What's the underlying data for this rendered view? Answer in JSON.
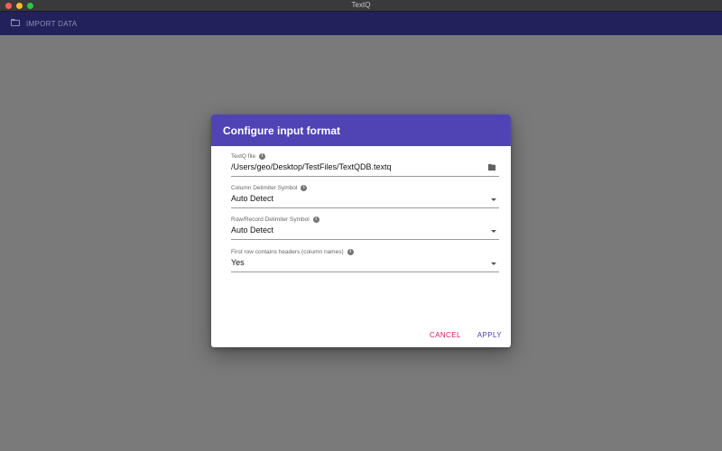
{
  "window": {
    "title": "TextQ"
  },
  "appbar": {
    "import_label": "IMPORT DATA",
    "icon": "folder-outline-icon"
  },
  "colors": {
    "appbar": "#22215c",
    "dialog_header": "#5044b4",
    "backdrop": "#7a7a7a",
    "cancel": "#d81b60",
    "apply": "#4a3fa6"
  },
  "dialog": {
    "title": "Configure input format",
    "fields": [
      {
        "label": "TextQ file",
        "value": "/Users/geo/Desktop/TestFiles/TextQDB.textq",
        "icon": "folder-icon"
      },
      {
        "label": "Column Delimiter Symbol",
        "value": "Auto Detect"
      },
      {
        "label": "Row/Record Delimiter Symbol",
        "value": "Auto Detect"
      },
      {
        "label": "First row contains headers (column names)",
        "value": "Yes"
      }
    ],
    "cancel_label": "CANCEL",
    "apply_label": "APPLY"
  }
}
